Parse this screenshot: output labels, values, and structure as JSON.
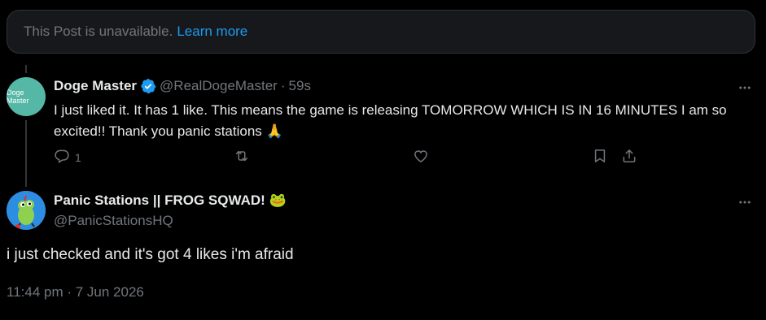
{
  "unavailable": {
    "message": "This Post is unavailable.",
    "link": "Learn more"
  },
  "post": {
    "author_avatar_text": "Doge Master",
    "author_name": "Doge Master",
    "verified": true,
    "handle": "@RealDogeMaster",
    "separator": "·",
    "time": "59s",
    "text": "I just liked it. It has 1 like. This means the game is releasing TOMORROW WHICH IS IN 16 MINUTES I am so excited!! Thank you panic stations 🙏",
    "actions": {
      "reply_count": "1",
      "retweet_count": "",
      "like_count": ""
    }
  },
  "reply": {
    "author_name": "Panic Stations || FROG SQWAD! 🐸",
    "handle": "@PanicStationsHQ",
    "text": "i just checked and it's got 4 likes i'm afraid",
    "timestamp": "11:44 pm · 7 Jun 2026"
  },
  "colors": {
    "background": "#000000",
    "text": "#e7e9ea",
    "secondary": "#71767b",
    "accent": "#1d9bf0"
  },
  "icons": [
    "verified-icon",
    "more-icon",
    "reply-icon",
    "retweet-icon",
    "like-icon",
    "bookmark-icon",
    "share-icon"
  ]
}
